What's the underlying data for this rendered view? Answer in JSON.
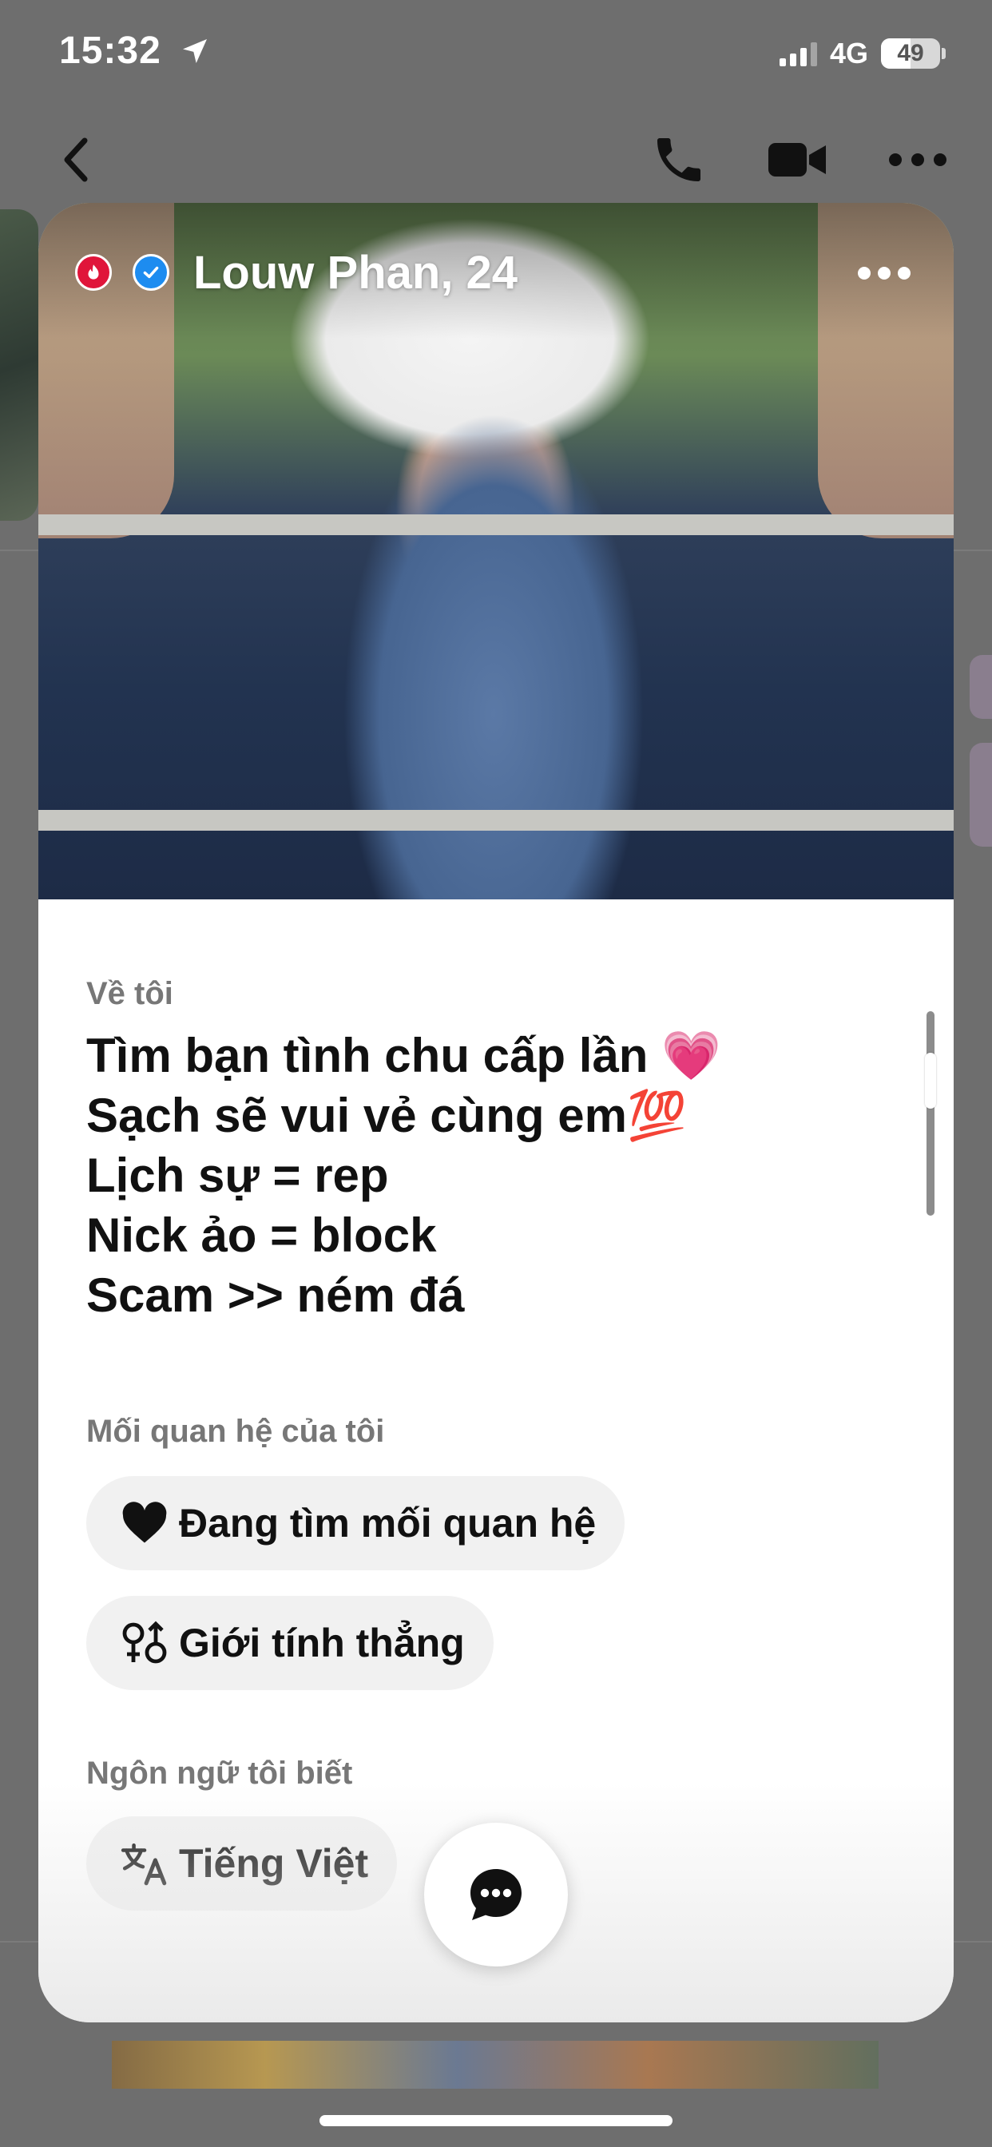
{
  "status_bar": {
    "time": "15:32",
    "network": "4G",
    "battery": "49"
  },
  "nav": {
    "back_icon": "chevron-left-icon",
    "call_icon": "phone-icon",
    "video_icon": "video-camera-icon",
    "more_icon": "more-horizontal-icon"
  },
  "profile": {
    "name_age": "Louw Phan, 24",
    "badges": [
      "flame-badge-icon",
      "verified-badge-icon"
    ],
    "about_label": "Về tôi",
    "about_text": "Tìm bạn tình chu cấp lần 💗\nSạch sẽ vui vẻ cùng em💯\nLịch sự = rep\nNick ảo = block\nScam >> ném đá",
    "relationship_label": "Mối quan hệ của tôi",
    "relationship_chip": "Đang tìm mối quan hệ",
    "gender_chip": "Giới tính thẳng",
    "languages_label": "Ngôn ngữ tôi biết",
    "language_chip": "Tiếng Việt"
  },
  "colors": {
    "overlay": "#6f6f6f",
    "card": "#ffffff",
    "chip": "#f1f1f1",
    "label_gray": "#777777",
    "verified_blue": "#1d8cf0",
    "badge_red": "#e0153a"
  },
  "fab": {
    "icon": "chat-bubble-icon"
  }
}
